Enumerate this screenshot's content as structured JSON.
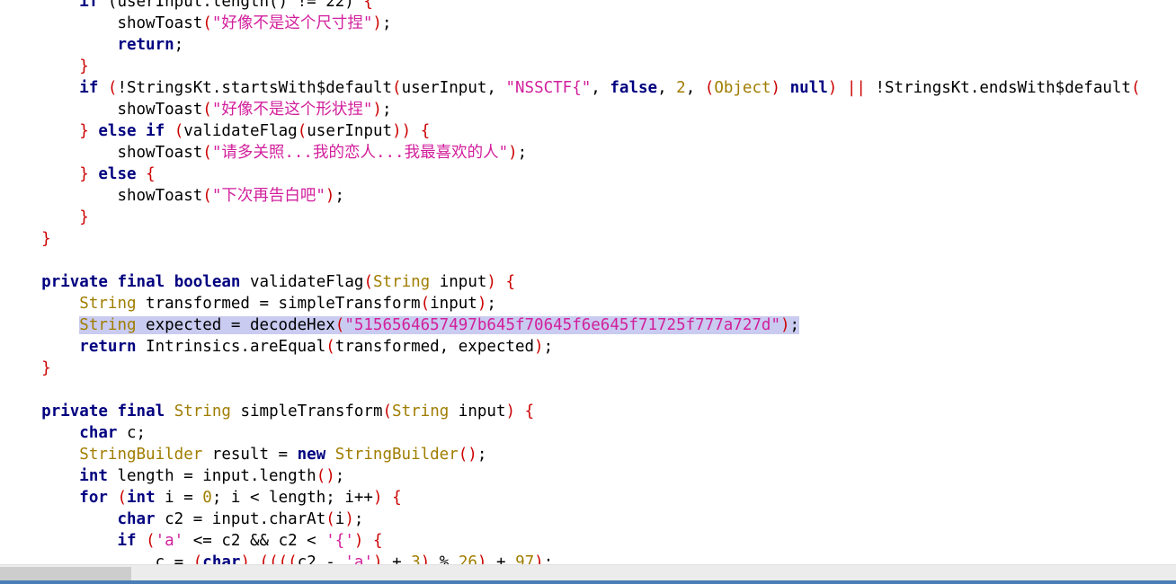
{
  "editor": {
    "lines": [
      {
        "indent": 2,
        "tokens": [
          [
            "kw",
            "if"
          ],
          [
            "p",
            " (userInput.length() != 22) "
          ],
          [
            "b",
            "{"
          ]
        ]
      },
      {
        "indent": 3,
        "tokens": [
          [
            "p",
            "showToast"
          ],
          [
            "b",
            "("
          ],
          [
            "s",
            "\"好像不是这个尺寸捏\""
          ],
          [
            "b",
            ")"
          ],
          [
            "p",
            ";"
          ]
        ]
      },
      {
        "indent": 3,
        "tokens": [
          [
            "kw",
            "return"
          ],
          [
            "p",
            ";"
          ]
        ]
      },
      {
        "indent": 2,
        "tokens": [
          [
            "b",
            "}"
          ]
        ]
      },
      {
        "indent": 2,
        "tokens": [
          [
            "kw",
            "if"
          ],
          [
            "p",
            " "
          ],
          [
            "b",
            "("
          ],
          [
            "p",
            "!StringsKt.startsWith$default"
          ],
          [
            "b",
            "("
          ],
          [
            "p",
            "userInput, "
          ],
          [
            "s",
            "\"NSSCTF{\""
          ],
          [
            "p",
            ", "
          ],
          [
            "kw",
            "false"
          ],
          [
            "p",
            ", "
          ],
          [
            "t",
            "2"
          ],
          [
            "p",
            ", "
          ],
          [
            "b",
            "("
          ],
          [
            "t",
            "Object"
          ],
          [
            "b",
            ")"
          ],
          [
            "p",
            " "
          ],
          [
            "kw",
            "null"
          ],
          [
            "b",
            ")"
          ],
          [
            "p",
            " "
          ],
          [
            "b",
            "||"
          ],
          [
            "p",
            " !StringsKt.endsWith$default"
          ],
          [
            "b",
            "("
          ]
        ]
      },
      {
        "indent": 3,
        "tokens": [
          [
            "p",
            "showToast"
          ],
          [
            "b",
            "("
          ],
          [
            "s",
            "\"好像不是这个形状捏\""
          ],
          [
            "b",
            ")"
          ],
          [
            "p",
            ";"
          ]
        ]
      },
      {
        "indent": 2,
        "tokens": [
          [
            "b",
            "}"
          ],
          [
            "p",
            " "
          ],
          [
            "kw",
            "else"
          ],
          [
            "p",
            " "
          ],
          [
            "kw",
            "if"
          ],
          [
            "p",
            " "
          ],
          [
            "b",
            "("
          ],
          [
            "p",
            "validateFlag"
          ],
          [
            "b",
            "("
          ],
          [
            "p",
            "userInput"
          ],
          [
            "b",
            "))"
          ],
          [
            "p",
            " "
          ],
          [
            "b",
            "{"
          ]
        ]
      },
      {
        "indent": 3,
        "tokens": [
          [
            "p",
            "showToast"
          ],
          [
            "b",
            "("
          ],
          [
            "s",
            "\"请多关照...我的恋人...我最喜欢的人\""
          ],
          [
            "b",
            ")"
          ],
          [
            "p",
            ";"
          ]
        ]
      },
      {
        "indent": 2,
        "tokens": [
          [
            "b",
            "}"
          ],
          [
            "p",
            " "
          ],
          [
            "kw",
            "else"
          ],
          [
            "p",
            " "
          ],
          [
            "b",
            "{"
          ]
        ]
      },
      {
        "indent": 3,
        "tokens": [
          [
            "p",
            "showToast"
          ],
          [
            "b",
            "("
          ],
          [
            "s",
            "\"下次再告白吧\""
          ],
          [
            "b",
            ")"
          ],
          [
            "p",
            ";"
          ]
        ]
      },
      {
        "indent": 2,
        "tokens": [
          [
            "b",
            "}"
          ]
        ]
      },
      {
        "indent": 1,
        "tokens": [
          [
            "b",
            "}"
          ]
        ]
      },
      {
        "indent": 0,
        "tokens": []
      },
      {
        "indent": 1,
        "tokens": [
          [
            "kw",
            "private"
          ],
          [
            "p",
            " "
          ],
          [
            "kw",
            "final"
          ],
          [
            "p",
            " "
          ],
          [
            "kw",
            "boolean"
          ],
          [
            "p",
            " validateFlag"
          ],
          [
            "b",
            "("
          ],
          [
            "t",
            "String"
          ],
          [
            "p",
            " input"
          ],
          [
            "b",
            ")"
          ],
          [
            "p",
            " "
          ],
          [
            "b",
            "{"
          ]
        ]
      },
      {
        "indent": 2,
        "tokens": [
          [
            "t",
            "String"
          ],
          [
            "p",
            " transformed = simpleTransform"
          ],
          [
            "b",
            "("
          ],
          [
            "p",
            "input"
          ],
          [
            "b",
            ")"
          ],
          [
            "p",
            ";"
          ]
        ]
      },
      {
        "indent": 2,
        "highlight": true,
        "tokens": [
          [
            "t",
            "String"
          ],
          [
            "p",
            " expected = decodeHex"
          ],
          [
            "b",
            "("
          ],
          [
            "s",
            "\"5156564657497b645f70645f6e645f71725f777a727d\""
          ],
          [
            "b",
            ")"
          ],
          [
            "p",
            ";"
          ]
        ]
      },
      {
        "indent": 2,
        "tokens": [
          [
            "kw",
            "return"
          ],
          [
            "p",
            " Intrinsics.areEqual"
          ],
          [
            "b",
            "("
          ],
          [
            "p",
            "transformed, expected"
          ],
          [
            "b",
            ")"
          ],
          [
            "p",
            ";"
          ]
        ]
      },
      {
        "indent": 1,
        "tokens": [
          [
            "b",
            "}"
          ]
        ]
      },
      {
        "indent": 0,
        "tokens": []
      },
      {
        "indent": 1,
        "tokens": [
          [
            "kw",
            "private"
          ],
          [
            "p",
            " "
          ],
          [
            "kw",
            "final"
          ],
          [
            "p",
            " "
          ],
          [
            "t",
            "String"
          ],
          [
            "p",
            " simpleTransform"
          ],
          [
            "b",
            "("
          ],
          [
            "t",
            "String"
          ],
          [
            "p",
            " input"
          ],
          [
            "b",
            ")"
          ],
          [
            "p",
            " "
          ],
          [
            "b",
            "{"
          ]
        ]
      },
      {
        "indent": 2,
        "tokens": [
          [
            "kw",
            "char"
          ],
          [
            "p",
            " c;"
          ]
        ]
      },
      {
        "indent": 2,
        "tokens": [
          [
            "t",
            "StringBuilder"
          ],
          [
            "p",
            " result = "
          ],
          [
            "kw",
            "new"
          ],
          [
            "p",
            " "
          ],
          [
            "t",
            "StringBuilder"
          ],
          [
            "b",
            "()"
          ],
          [
            "p",
            ";"
          ]
        ]
      },
      {
        "indent": 2,
        "tokens": [
          [
            "kw",
            "int"
          ],
          [
            "p",
            " length = input.length"
          ],
          [
            "b",
            "()"
          ],
          [
            "p",
            ";"
          ]
        ]
      },
      {
        "indent": 2,
        "tokens": [
          [
            "kw",
            "for"
          ],
          [
            "p",
            " "
          ],
          [
            "b",
            "("
          ],
          [
            "kw",
            "int"
          ],
          [
            "p",
            " i = "
          ],
          [
            "t",
            "0"
          ],
          [
            "p",
            "; i < length; i++"
          ],
          [
            "b",
            ")"
          ],
          [
            "p",
            " "
          ],
          [
            "b",
            "{"
          ]
        ]
      },
      {
        "indent": 3,
        "tokens": [
          [
            "kw",
            "char"
          ],
          [
            "p",
            " c2 = input.charAt"
          ],
          [
            "b",
            "("
          ],
          [
            "p",
            "i"
          ],
          [
            "b",
            ")"
          ],
          [
            "p",
            ";"
          ]
        ]
      },
      {
        "indent": 3,
        "tokens": [
          [
            "kw",
            "if"
          ],
          [
            "p",
            " "
          ],
          [
            "b",
            "("
          ],
          [
            "s",
            "'a'"
          ],
          [
            "p",
            " <= c2 && c2 < "
          ],
          [
            "s",
            "'{'"
          ],
          [
            "b",
            ")"
          ],
          [
            "p",
            " "
          ],
          [
            "b",
            "{"
          ]
        ]
      },
      {
        "indent": 4,
        "tokens": [
          [
            "p",
            "c = "
          ],
          [
            "b",
            "("
          ],
          [
            "kw",
            "char"
          ],
          [
            "b",
            ")"
          ],
          [
            "p",
            " "
          ],
          [
            "b",
            "(((("
          ],
          [
            "p",
            "c2 - "
          ],
          [
            "s",
            "'a'"
          ],
          [
            "b",
            ")"
          ],
          [
            "p",
            " + "
          ],
          [
            "t",
            "3"
          ],
          [
            "b",
            ")"
          ],
          [
            "p",
            " % "
          ],
          [
            "t",
            "26"
          ],
          [
            "b",
            ")"
          ],
          [
            "p",
            " + "
          ],
          [
            "t",
            "97"
          ],
          [
            "b",
            ")"
          ],
          [
            "p",
            ";"
          ]
        ]
      }
    ]
  },
  "colors": {
    "keyword": "#000080",
    "type": "#a07d00",
    "brace": "#cc0000",
    "string": "#d21f9c",
    "highlight": "#c9cbf0",
    "scrollbar_track": "#ececec",
    "scrollbar_thumb": "#cdcdcd",
    "bottom_strip": "#4a7eb6"
  }
}
